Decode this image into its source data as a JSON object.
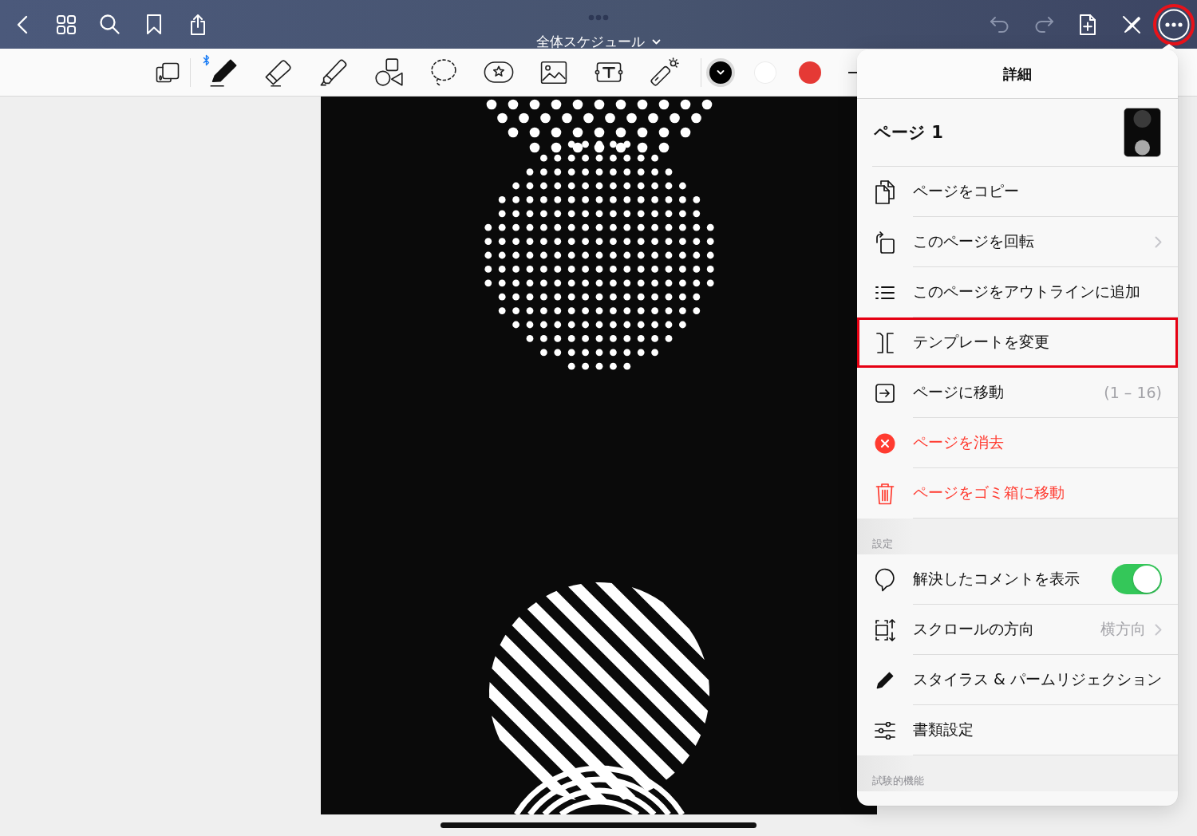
{
  "top_bar": {
    "left_buttons": [
      {
        "kind": "back"
      },
      {
        "kind": "grid"
      },
      {
        "kind": "search"
      },
      {
        "kind": "bookmark"
      },
      {
        "kind": "share"
      }
    ],
    "title": "全体スケジュール",
    "right_buttons": [
      {
        "kind": "undo",
        "disabled": true,
        "highlighted": false
      },
      {
        "kind": "redo",
        "disabled": true,
        "highlighted": false
      },
      {
        "kind": "add-page",
        "disabled": false,
        "highlighted": false
      },
      {
        "kind": "pen-off",
        "disabled": false,
        "highlighted": false
      },
      {
        "kind": "more",
        "disabled": false,
        "highlighted": true
      }
    ]
  },
  "toolbar": {
    "stylus_connected": true,
    "tools": [
      {
        "kind": "pen",
        "selected": true
      },
      {
        "kind": "eraser",
        "selected": false
      },
      {
        "kind": "highlighter",
        "selected": false
      },
      {
        "kind": "shapes",
        "selected": false
      },
      {
        "kind": "lasso",
        "selected": false
      },
      {
        "kind": "sticker",
        "selected": false
      },
      {
        "kind": "image",
        "selected": false
      },
      {
        "kind": "text",
        "selected": false
      },
      {
        "kind": "laser",
        "selected": false
      }
    ],
    "colors": [
      {
        "color": "#000000",
        "selected": true
      },
      {
        "color": "#ffffff",
        "selected": false
      },
      {
        "color": "#e53935",
        "selected": false
      }
    ]
  },
  "menu": {
    "title": "詳細",
    "page_label": "ページ 1",
    "sections": [
      {
        "items": [
          {
            "kind": "copy",
            "label": "ページをコピー",
            "destructive": false,
            "chevron": false,
            "highlighted": false
          },
          {
            "kind": "rotate",
            "label": "このページを回転",
            "destructive": false,
            "chevron": true,
            "highlighted": false
          },
          {
            "kind": "outline",
            "label": "このページをアウトラインに追加",
            "destructive": false,
            "chevron": false,
            "highlighted": false
          },
          {
            "kind": "template",
            "label": "テンプレートを変更",
            "destructive": false,
            "chevron": false,
            "highlighted": true
          },
          {
            "kind": "go-to",
            "label": "ページに移動",
            "value": "(1 – 16)",
            "destructive": false,
            "chevron": false,
            "highlighted": false
          },
          {
            "kind": "delete",
            "label": "ページを消去",
            "destructive": true,
            "chevron": false,
            "highlighted": false
          },
          {
            "kind": "trash",
            "label": "ページをゴミ箱に移動",
            "destructive": true,
            "chevron": false,
            "highlighted": false
          }
        ]
      },
      {
        "header": "設定",
        "items": [
          {
            "kind": "comment",
            "label": "解決したコメントを表示",
            "switch": {
              "on": true
            },
            "destructive": false,
            "chevron": false,
            "highlighted": false
          },
          {
            "kind": "scroll",
            "label": "スクロールの方向",
            "value": "横方向",
            "destructive": false,
            "chevron": true,
            "highlighted": false
          },
          {
            "kind": "stylus",
            "label": "スタイラス & パームリジェクション",
            "destructive": false,
            "chevron": false,
            "highlighted": false
          },
          {
            "kind": "settings",
            "label": "書類設定",
            "destructive": false,
            "chevron": false,
            "highlighted": false
          }
        ]
      },
      {
        "header": "試験的機能"
      }
    ]
  }
}
